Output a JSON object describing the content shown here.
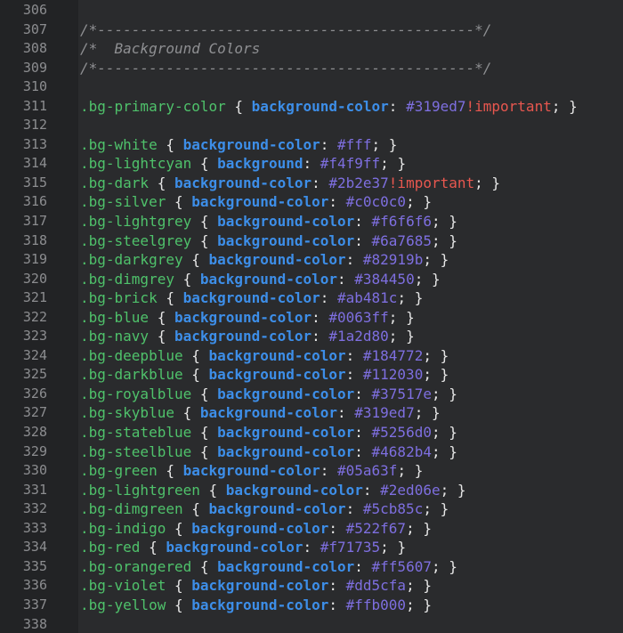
{
  "editor": {
    "colors": {
      "background": "#2a2b2d",
      "gutter": "#222325",
      "line_number": "#8c8d90",
      "comment": "#8e8f92",
      "selector": "#4fc26b",
      "property": "#3d8ee8",
      "value": "#7e6fe0",
      "important": "#e8574f",
      "punctuation": "#e6e6e6"
    },
    "lines": [
      {
        "n": "306",
        "tokens": []
      },
      {
        "n": "307",
        "tokens": [
          {
            "t": "comment",
            "v": "/*--------------------------------------------*/"
          }
        ]
      },
      {
        "n": "308",
        "tokens": [
          {
            "t": "comment",
            "v": "/*  Background Colors"
          }
        ]
      },
      {
        "n": "309",
        "tokens": [
          {
            "t": "comment",
            "v": "/*--------------------------------------------*/"
          }
        ]
      },
      {
        "n": "310",
        "tokens": []
      },
      {
        "n": "311",
        "tokens": [
          {
            "t": "selector",
            "v": ".bg-primary-color"
          },
          {
            "t": "punct",
            "v": " { "
          },
          {
            "t": "prop",
            "v": "background-color"
          },
          {
            "t": "punct",
            "v": ": "
          },
          {
            "t": "value",
            "v": "#319ed7"
          },
          {
            "t": "important",
            "v": "!important"
          },
          {
            "t": "punct",
            "v": "; }"
          }
        ]
      },
      {
        "n": "312",
        "tokens": []
      },
      {
        "n": "313",
        "tokens": [
          {
            "t": "selector",
            "v": ".bg-white"
          },
          {
            "t": "punct",
            "v": " { "
          },
          {
            "t": "prop",
            "v": "background-color"
          },
          {
            "t": "punct",
            "v": ": "
          },
          {
            "t": "value",
            "v": "#fff"
          },
          {
            "t": "punct",
            "v": "; }"
          }
        ]
      },
      {
        "n": "314",
        "tokens": [
          {
            "t": "selector",
            "v": ".bg-lightcyan"
          },
          {
            "t": "punct",
            "v": " { "
          },
          {
            "t": "prop",
            "v": "background"
          },
          {
            "t": "punct",
            "v": ": "
          },
          {
            "t": "value",
            "v": "#f4f9ff"
          },
          {
            "t": "punct",
            "v": "; }"
          }
        ]
      },
      {
        "n": "315",
        "tokens": [
          {
            "t": "selector",
            "v": ".bg-dark"
          },
          {
            "t": "punct",
            "v": " { "
          },
          {
            "t": "prop",
            "v": "background-color"
          },
          {
            "t": "punct",
            "v": ": "
          },
          {
            "t": "value",
            "v": "#2b2e37"
          },
          {
            "t": "important",
            "v": "!important"
          },
          {
            "t": "punct",
            "v": "; }"
          }
        ]
      },
      {
        "n": "316",
        "tokens": [
          {
            "t": "selector",
            "v": ".bg-silver"
          },
          {
            "t": "punct",
            "v": " { "
          },
          {
            "t": "prop",
            "v": "background-color"
          },
          {
            "t": "punct",
            "v": ": "
          },
          {
            "t": "value",
            "v": "#c0c0c0"
          },
          {
            "t": "punct",
            "v": "; }"
          }
        ]
      },
      {
        "n": "317",
        "tokens": [
          {
            "t": "selector",
            "v": ".bg-lightgrey"
          },
          {
            "t": "punct",
            "v": " { "
          },
          {
            "t": "prop",
            "v": "background-color"
          },
          {
            "t": "punct",
            "v": ": "
          },
          {
            "t": "value",
            "v": "#f6f6f6"
          },
          {
            "t": "punct",
            "v": "; }"
          }
        ]
      },
      {
        "n": "318",
        "tokens": [
          {
            "t": "selector",
            "v": ".bg-steelgrey"
          },
          {
            "t": "punct",
            "v": " { "
          },
          {
            "t": "prop",
            "v": "background-color"
          },
          {
            "t": "punct",
            "v": ": "
          },
          {
            "t": "value",
            "v": "#6a7685"
          },
          {
            "t": "punct",
            "v": "; }"
          }
        ]
      },
      {
        "n": "319",
        "tokens": [
          {
            "t": "selector",
            "v": ".bg-darkgrey"
          },
          {
            "t": "punct",
            "v": " { "
          },
          {
            "t": "prop",
            "v": "background-color"
          },
          {
            "t": "punct",
            "v": ": "
          },
          {
            "t": "value",
            "v": "#82919b"
          },
          {
            "t": "punct",
            "v": "; }"
          }
        ]
      },
      {
        "n": "320",
        "tokens": [
          {
            "t": "selector",
            "v": ".bg-dimgrey"
          },
          {
            "t": "punct",
            "v": " { "
          },
          {
            "t": "prop",
            "v": "background-color"
          },
          {
            "t": "punct",
            "v": ": "
          },
          {
            "t": "value",
            "v": "#384450"
          },
          {
            "t": "punct",
            "v": "; }"
          }
        ]
      },
      {
        "n": "321",
        "tokens": [
          {
            "t": "selector",
            "v": ".bg-brick"
          },
          {
            "t": "punct",
            "v": " { "
          },
          {
            "t": "prop",
            "v": "background-color"
          },
          {
            "t": "punct",
            "v": ": "
          },
          {
            "t": "value",
            "v": "#ab481c"
          },
          {
            "t": "punct",
            "v": "; }"
          }
        ]
      },
      {
        "n": "322",
        "tokens": [
          {
            "t": "selector",
            "v": ".bg-blue"
          },
          {
            "t": "punct",
            "v": " { "
          },
          {
            "t": "prop",
            "v": "background-color"
          },
          {
            "t": "punct",
            "v": ": "
          },
          {
            "t": "value",
            "v": "#0063ff"
          },
          {
            "t": "punct",
            "v": "; }"
          }
        ]
      },
      {
        "n": "323",
        "tokens": [
          {
            "t": "selector",
            "v": ".bg-navy"
          },
          {
            "t": "punct",
            "v": " { "
          },
          {
            "t": "prop",
            "v": "background-color"
          },
          {
            "t": "punct",
            "v": ": "
          },
          {
            "t": "value",
            "v": "#1a2d80"
          },
          {
            "t": "punct",
            "v": "; }"
          }
        ]
      },
      {
        "n": "324",
        "tokens": [
          {
            "t": "selector",
            "v": ".bg-deepblue"
          },
          {
            "t": "punct",
            "v": " { "
          },
          {
            "t": "prop",
            "v": "background-color"
          },
          {
            "t": "punct",
            "v": ": "
          },
          {
            "t": "value",
            "v": "#184772"
          },
          {
            "t": "punct",
            "v": "; }"
          }
        ]
      },
      {
        "n": "325",
        "tokens": [
          {
            "t": "selector",
            "v": ".bg-darkblue"
          },
          {
            "t": "punct",
            "v": " { "
          },
          {
            "t": "prop",
            "v": "background-color"
          },
          {
            "t": "punct",
            "v": ": "
          },
          {
            "t": "value",
            "v": "#112030"
          },
          {
            "t": "punct",
            "v": "; }"
          }
        ]
      },
      {
        "n": "326",
        "tokens": [
          {
            "t": "selector",
            "v": ".bg-royalblue"
          },
          {
            "t": "punct",
            "v": " { "
          },
          {
            "t": "prop",
            "v": "background-color"
          },
          {
            "t": "punct",
            "v": ": "
          },
          {
            "t": "value",
            "v": "#37517e"
          },
          {
            "t": "punct",
            "v": "; }"
          }
        ]
      },
      {
        "n": "327",
        "tokens": [
          {
            "t": "selector",
            "v": ".bg-skyblue"
          },
          {
            "t": "punct",
            "v": " { "
          },
          {
            "t": "prop",
            "v": "background-color"
          },
          {
            "t": "punct",
            "v": ": "
          },
          {
            "t": "value",
            "v": "#319ed7"
          },
          {
            "t": "punct",
            "v": "; }"
          }
        ]
      },
      {
        "n": "328",
        "tokens": [
          {
            "t": "selector",
            "v": ".bg-stateblue"
          },
          {
            "t": "punct",
            "v": " { "
          },
          {
            "t": "prop",
            "v": "background-color"
          },
          {
            "t": "punct",
            "v": ": "
          },
          {
            "t": "value",
            "v": "#5256d0"
          },
          {
            "t": "punct",
            "v": "; }"
          }
        ]
      },
      {
        "n": "329",
        "tokens": [
          {
            "t": "selector",
            "v": ".bg-steelblue"
          },
          {
            "t": "punct",
            "v": " { "
          },
          {
            "t": "prop",
            "v": "background-color"
          },
          {
            "t": "punct",
            "v": ": "
          },
          {
            "t": "value",
            "v": "#4682b4"
          },
          {
            "t": "punct",
            "v": "; }"
          }
        ]
      },
      {
        "n": "330",
        "tokens": [
          {
            "t": "selector",
            "v": ".bg-green"
          },
          {
            "t": "punct",
            "v": " { "
          },
          {
            "t": "prop",
            "v": "background-color"
          },
          {
            "t": "punct",
            "v": ": "
          },
          {
            "t": "value",
            "v": "#05a63f"
          },
          {
            "t": "punct",
            "v": "; }"
          }
        ]
      },
      {
        "n": "331",
        "tokens": [
          {
            "t": "selector",
            "v": ".bg-lightgreen"
          },
          {
            "t": "punct",
            "v": " { "
          },
          {
            "t": "prop",
            "v": "background-color"
          },
          {
            "t": "punct",
            "v": ": "
          },
          {
            "t": "value",
            "v": "#2ed06e"
          },
          {
            "t": "punct",
            "v": "; }"
          }
        ]
      },
      {
        "n": "332",
        "tokens": [
          {
            "t": "selector",
            "v": ".bg-dimgreen"
          },
          {
            "t": "punct",
            "v": " { "
          },
          {
            "t": "prop",
            "v": "background-color"
          },
          {
            "t": "punct",
            "v": ": "
          },
          {
            "t": "value",
            "v": "#5cb85c"
          },
          {
            "t": "punct",
            "v": "; }"
          }
        ]
      },
      {
        "n": "333",
        "tokens": [
          {
            "t": "selector",
            "v": ".bg-indigo"
          },
          {
            "t": "punct",
            "v": " { "
          },
          {
            "t": "prop",
            "v": "background-color"
          },
          {
            "t": "punct",
            "v": ": "
          },
          {
            "t": "value",
            "v": "#522f67"
          },
          {
            "t": "punct",
            "v": "; }"
          }
        ]
      },
      {
        "n": "334",
        "tokens": [
          {
            "t": "selector",
            "v": ".bg-red"
          },
          {
            "t": "punct",
            "v": " { "
          },
          {
            "t": "prop",
            "v": "background-color"
          },
          {
            "t": "punct",
            "v": ": "
          },
          {
            "t": "value",
            "v": "#f71735"
          },
          {
            "t": "punct",
            "v": "; }"
          }
        ]
      },
      {
        "n": "335",
        "tokens": [
          {
            "t": "selector",
            "v": ".bg-orangered"
          },
          {
            "t": "punct",
            "v": " { "
          },
          {
            "t": "prop",
            "v": "background-color"
          },
          {
            "t": "punct",
            "v": ": "
          },
          {
            "t": "value",
            "v": "#ff5607"
          },
          {
            "t": "punct",
            "v": "; }"
          }
        ]
      },
      {
        "n": "336",
        "tokens": [
          {
            "t": "selector",
            "v": ".bg-violet"
          },
          {
            "t": "punct",
            "v": " { "
          },
          {
            "t": "prop",
            "v": "background-color"
          },
          {
            "t": "punct",
            "v": ": "
          },
          {
            "t": "value",
            "v": "#dd5cfa"
          },
          {
            "t": "punct",
            "v": "; }"
          }
        ]
      },
      {
        "n": "337",
        "tokens": [
          {
            "t": "selector",
            "v": ".bg-yellow"
          },
          {
            "t": "punct",
            "v": " { "
          },
          {
            "t": "prop",
            "v": "background-color"
          },
          {
            "t": "punct",
            "v": ": "
          },
          {
            "t": "value",
            "v": "#ffb000"
          },
          {
            "t": "punct",
            "v": "; }"
          }
        ]
      },
      {
        "n": "338",
        "tokens": []
      }
    ]
  }
}
